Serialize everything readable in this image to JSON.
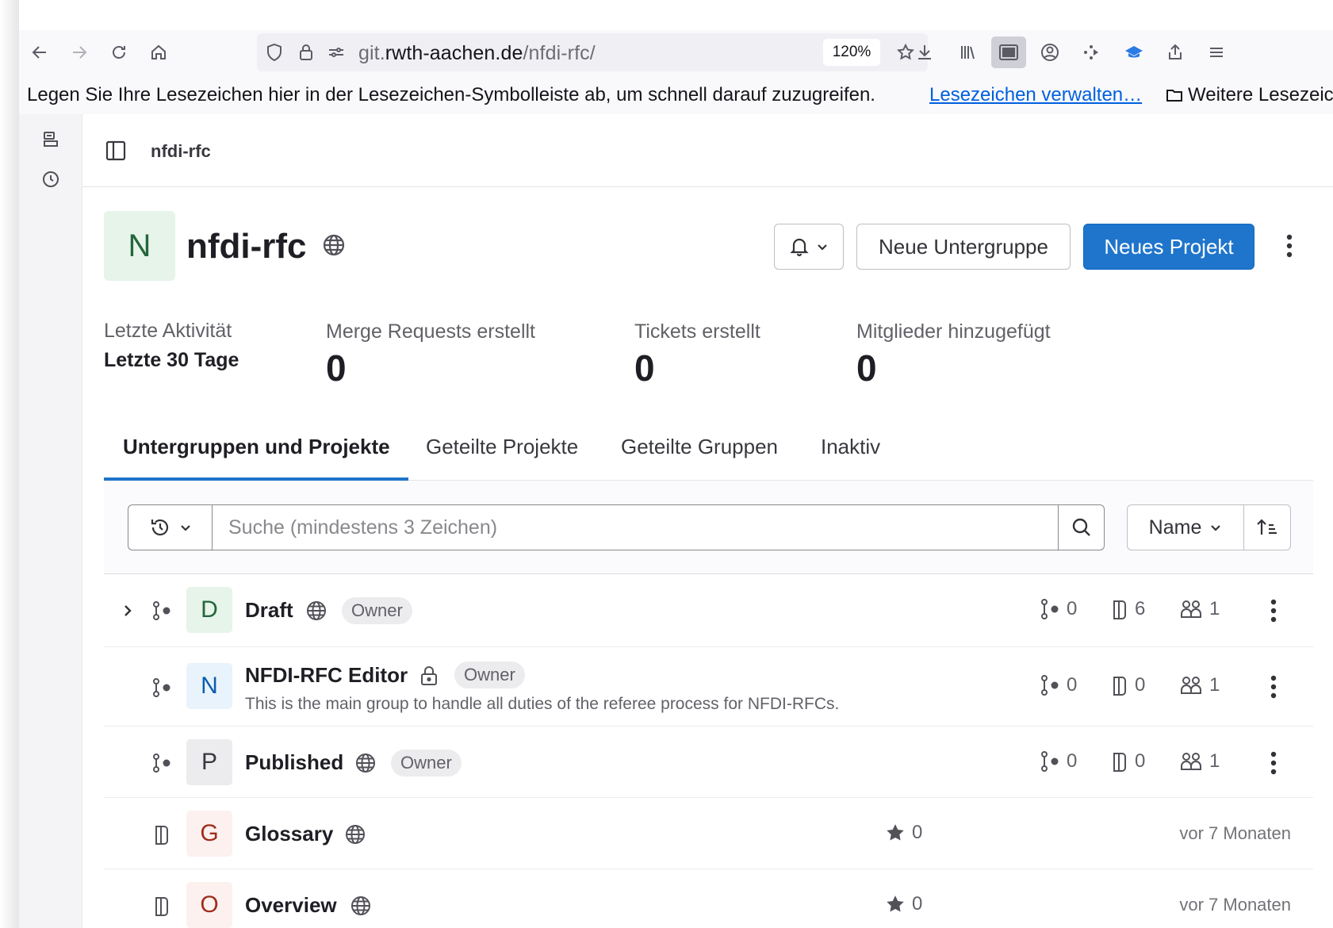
{
  "browser": {
    "url_prefix": "git.",
    "url_host": "rwth-aachen.de",
    "url_path": "/nfdi-rfc/",
    "zoom": "120%",
    "bookmarks_message": "Legen Sie Ihre Lesezeichen hier in der Lesezeichen-Symbolleiste ab, um schnell darauf zuzugreifen.",
    "bookmarks_manage": "Lesezeichen verwalten…",
    "bookmarks_more": "Weitere Lesezeic"
  },
  "breadcrumb": {
    "current": "nfdi-rfc"
  },
  "group": {
    "avatar_letter": "N",
    "name": "nfdi-rfc",
    "new_subgroup_label": "Neue Untergruppe",
    "new_project_label": "Neues Projekt"
  },
  "activity": {
    "label": "Letzte Aktivität",
    "period": "Letzte 30 Tage",
    "stats": [
      {
        "label": "Merge Requests erstellt",
        "value": "0"
      },
      {
        "label": "Tickets erstellt",
        "value": "0"
      },
      {
        "label": "Mitglieder hinzugefügt",
        "value": "0"
      }
    ]
  },
  "tabs": [
    {
      "label": "Untergruppen und Projekte",
      "active": true
    },
    {
      "label": "Geteilte Projekte",
      "active": false
    },
    {
      "label": "Geteilte Gruppen",
      "active": false
    },
    {
      "label": "Inaktiv",
      "active": false
    }
  ],
  "filter": {
    "search_placeholder": "Suche (mindestens 3 Zeichen)",
    "sort_label": "Name"
  },
  "items": [
    {
      "type": "group",
      "expandable": true,
      "letter": "D",
      "name": "Draft",
      "visibility": "globe-icon",
      "badge": "Owner",
      "description": "",
      "subgroups": "0",
      "projects": "6",
      "members": "1"
    },
    {
      "type": "group",
      "expandable": false,
      "letter": "N",
      "name": "NFDI-RFC Editor",
      "visibility": "lock-icon",
      "badge": "Owner",
      "description": "This is the main group to handle all duties of the referee process for NFDI-RFCs.",
      "subgroups": "0",
      "projects": "0",
      "members": "1"
    },
    {
      "type": "group",
      "expandable": false,
      "letter": "P",
      "name": "Published",
      "visibility": "globe-icon",
      "badge": "Owner",
      "description": "",
      "subgroups": "0",
      "projects": "0",
      "members": "1"
    },
    {
      "type": "project",
      "letter": "G",
      "name": "Glossary",
      "visibility": "globe-icon",
      "stars": "0",
      "updated": "vor 7 Monaten"
    },
    {
      "type": "project",
      "letter": "O",
      "name": "Overview",
      "visibility": "globe-icon",
      "stars": "0",
      "updated": "vor 7 Monaten"
    }
  ],
  "colors": {
    "primary": "#1f75cb",
    "avatar_green_bg": "#e6f4ea",
    "avatar_blue_bg": "#e9f3fc",
    "avatar_gray_bg": "#ececef",
    "avatar_red_bg": "#fcf1ef",
    "link": "#0060df"
  }
}
